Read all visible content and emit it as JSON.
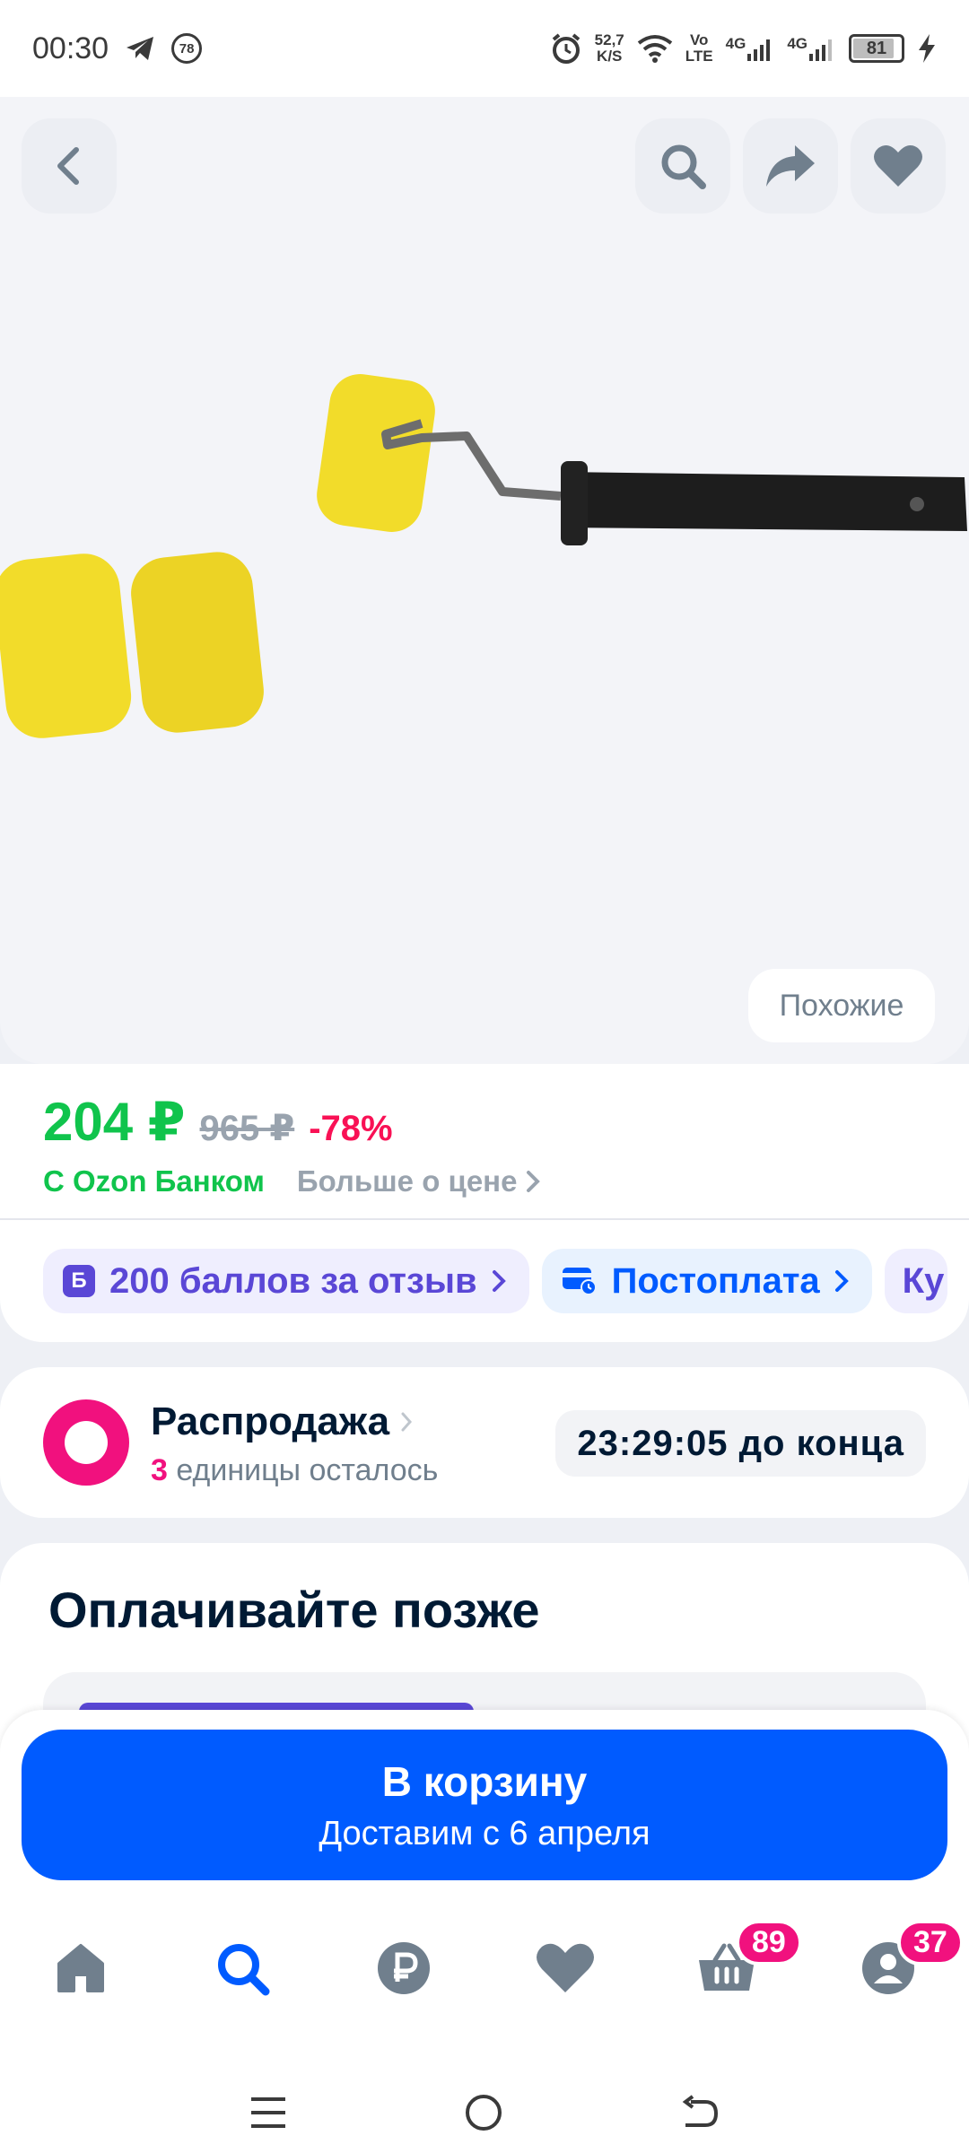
{
  "status_bar": {
    "time": "00:30",
    "notif_badge": "78",
    "net_speed_value": "52,7",
    "net_speed_unit": "K/S",
    "volte_top": "Vo",
    "volte_bottom": "LTE",
    "net1": "4G",
    "net2": "4G",
    "battery": "81"
  },
  "gallery": {
    "similar_label": "Похожие"
  },
  "price": {
    "current": "204 ₽",
    "old": "965 ₽",
    "discount": "-78%",
    "bank_label": "С Ozon Банком",
    "more_label": "Больше о цене"
  },
  "chips": {
    "points_icon": "Б",
    "points_label": "200 баллов за отзыв",
    "postpay_label": "Постоплата",
    "cut_label": "Ку"
  },
  "sale": {
    "title": "Распродажа",
    "count": "3",
    "remaining": "единицы осталось",
    "timer": "23:29:05 до конца"
  },
  "paylater": {
    "title": "Оплачивайте позже"
  },
  "cart": {
    "label": "В корзину",
    "delivery": "Доставим с 6 апреля"
  },
  "tabbar": {
    "cart_badge": "89",
    "profile_badge": "37"
  },
  "colors": {
    "primary": "#005bff",
    "price_green": "#10c44c",
    "discount_pink": "#f91155",
    "badge_pink": "#f1117e",
    "points_purple": "#5a47d6"
  }
}
